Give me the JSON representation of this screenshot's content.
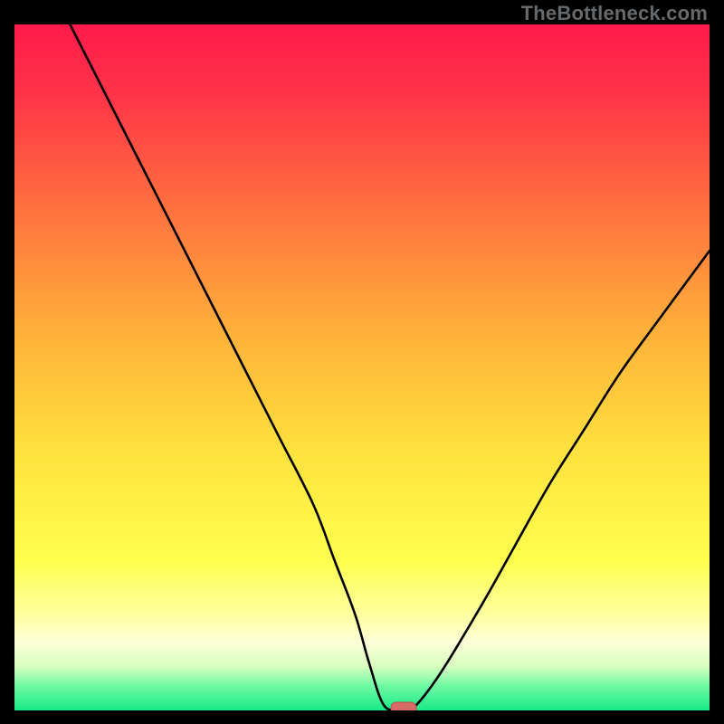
{
  "watermark": "TheBottleneck.com",
  "colors": {
    "frame_bg": "#000000",
    "watermark": "#66696c",
    "curve": "#000000",
    "marker_fill": "#d86b68",
    "marker_stroke": "#b84c4a",
    "gradient_stops": [
      {
        "offset": 0.0,
        "color": "#ff1a4b"
      },
      {
        "offset": 0.1,
        "color": "#ff3348"
      },
      {
        "offset": 0.25,
        "color": "#ff6a3f"
      },
      {
        "offset": 0.45,
        "color": "#ffb13a"
      },
      {
        "offset": 0.62,
        "color": "#ffe13d"
      },
      {
        "offset": 0.78,
        "color": "#ffff4d"
      },
      {
        "offset": 0.86,
        "color": "#feff9e"
      },
      {
        "offset": 0.9,
        "color": "#fdffd7"
      },
      {
        "offset": 0.935,
        "color": "#d9ffbf"
      },
      {
        "offset": 0.965,
        "color": "#6ef9a4"
      },
      {
        "offset": 1.0,
        "color": "#17e987"
      }
    ]
  },
  "chart_data": {
    "type": "line",
    "title": "",
    "xlabel": "",
    "ylabel": "",
    "xlim": [
      0,
      100
    ],
    "ylim": [
      0,
      100
    ],
    "grid": false,
    "legend": false,
    "x": [
      8,
      15,
      21,
      27,
      33,
      38,
      43,
      46,
      49,
      51,
      53,
      55,
      57,
      61,
      67,
      72,
      77,
      82,
      87,
      92,
      100
    ],
    "values": [
      100,
      86,
      74,
      62,
      50,
      40,
      30,
      22,
      14,
      7,
      1,
      0,
      0,
      5,
      15,
      24,
      33,
      41,
      49,
      56,
      67
    ],
    "marker": {
      "x": 56,
      "y": 0
    }
  }
}
